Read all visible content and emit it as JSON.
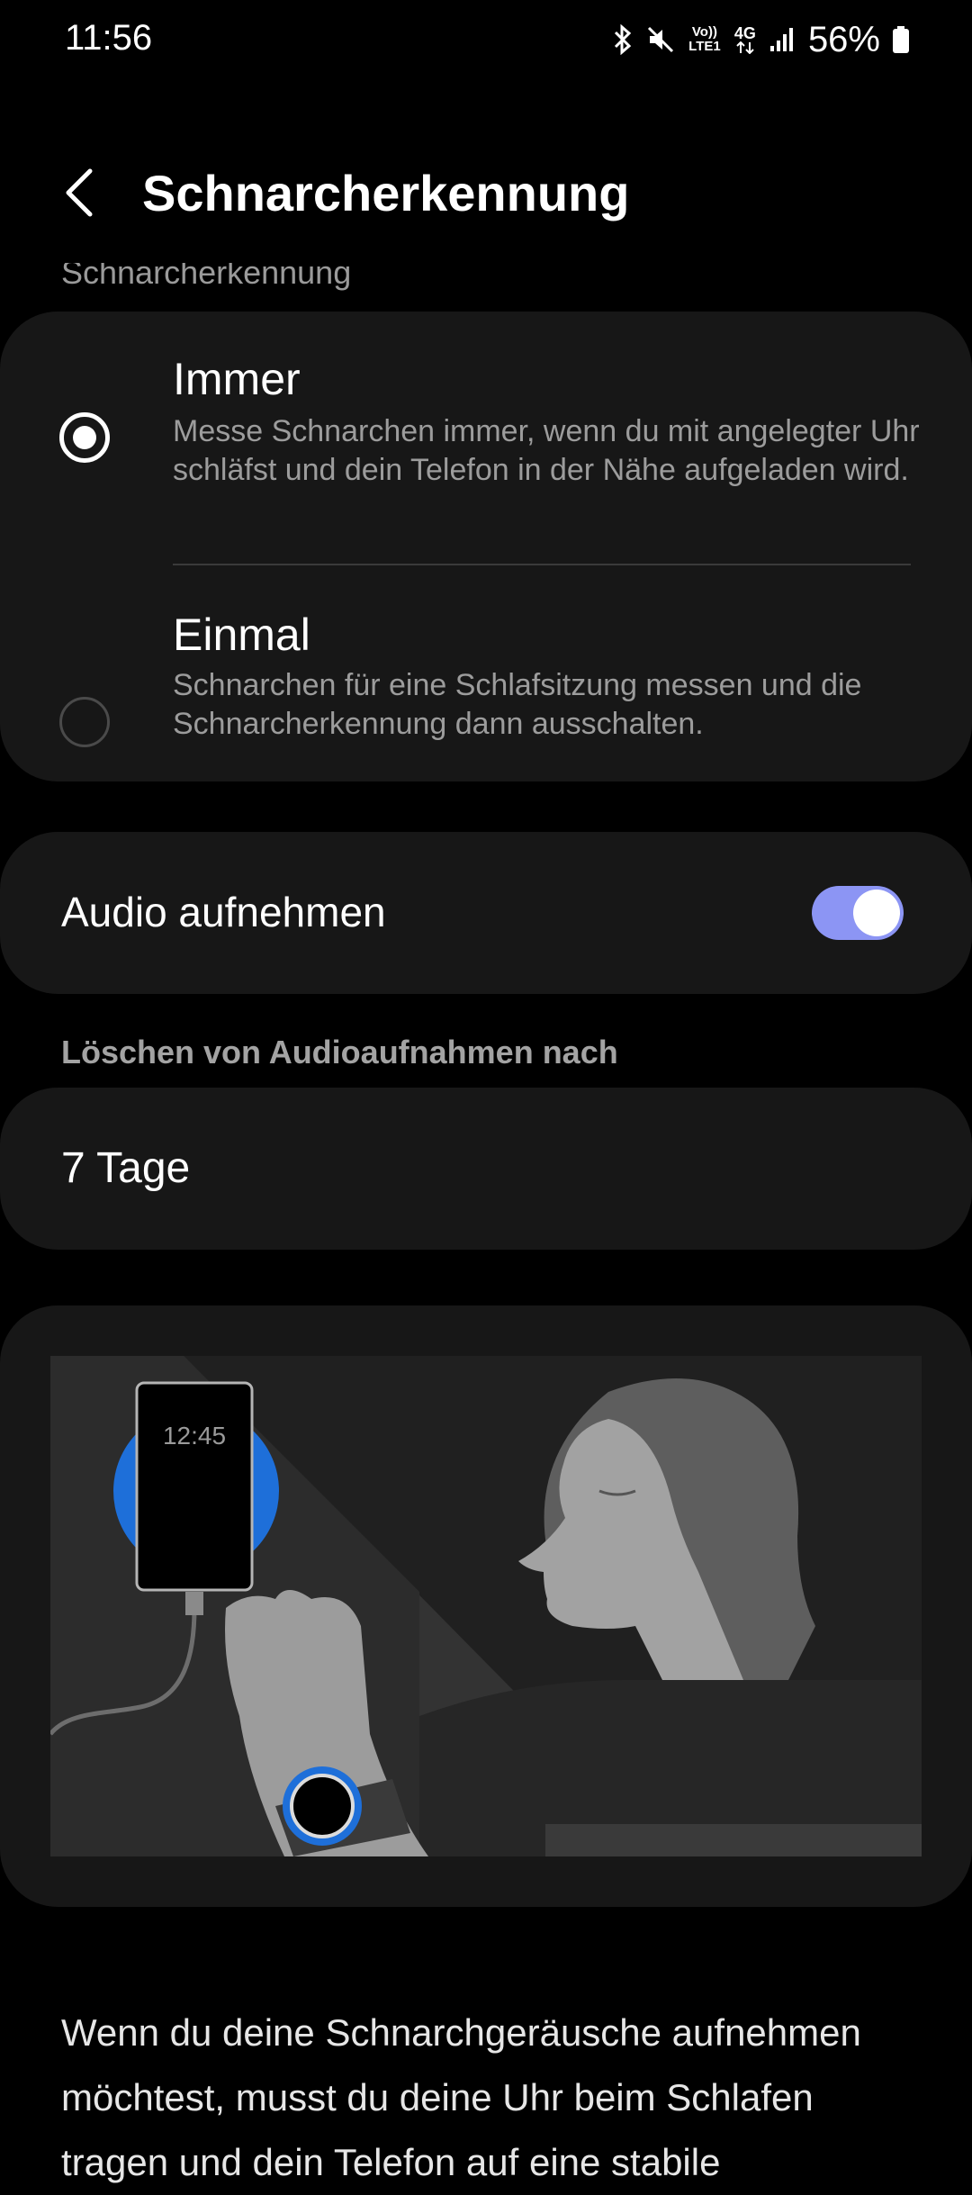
{
  "status_bar": {
    "time": "11:56",
    "battery": "56%",
    "network": "4G",
    "volte": "Vo)) LTE1",
    "icons": [
      "bluetooth-icon",
      "mute-icon",
      "volte-icon",
      "4g-icon",
      "signal-icon",
      "battery-icon"
    ]
  },
  "header": {
    "title": "Schnarcherkennung"
  },
  "sections": {
    "cut_label": "Schnarcherkennung",
    "delete_label": "Löschen von Audioaufnahmen nach"
  },
  "options": [
    {
      "title": "Immer",
      "description": "Messe Schnarchen immer, wenn du mit angelegter Uhr schläfst und dein Telefon in der Nähe aufgeladen wird.",
      "selected": true
    },
    {
      "title": "Einmal",
      "description": "Schnarchen für eine Schlafsitzung messen und die Schnarcherkennung dann ausschalten.",
      "selected": false
    }
  ],
  "audio": {
    "label": "Audio aufnehmen",
    "enabled": true
  },
  "delete_after": {
    "value": "7 Tage"
  },
  "illustration": {
    "phone_time": "12:45"
  },
  "body_text": "Wenn du deine Schnarchgeräusche aufnehmen möchtest, musst du deine Uhr beim Schlafen tragen und dein Telefon auf eine stabile",
  "colors": {
    "background": "#000000",
    "card": "#171717",
    "toggle_on": "#8c95f4",
    "accent_blue": "#1e6fd9"
  }
}
